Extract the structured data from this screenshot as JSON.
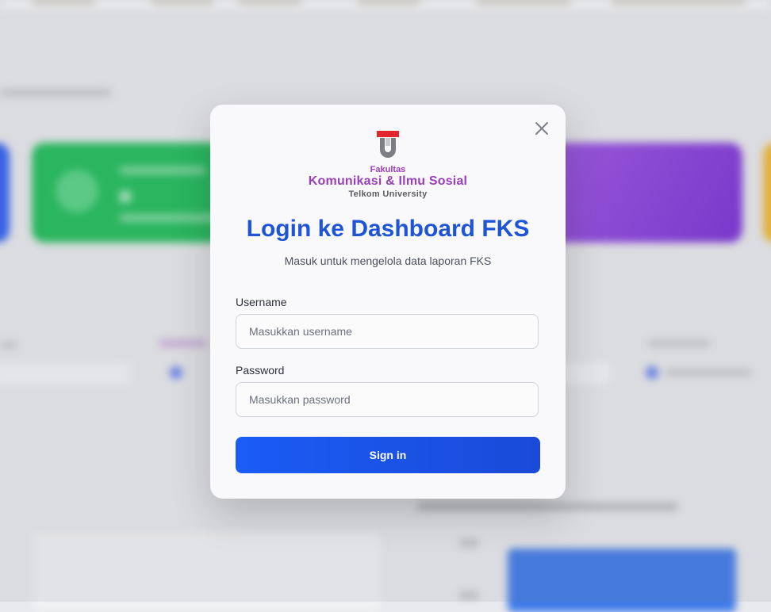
{
  "modal": {
    "logo": {
      "faculty_prefix": "Fakultas",
      "faculty_name": "Komunikasi & Ilmu Sosial",
      "university": "Telkom University"
    },
    "title": "Login ke Dashboard FKS",
    "subtitle": "Masuk untuk mengelola data laporan FKS",
    "username": {
      "label": "Username",
      "placeholder": "Masukkan username",
      "value": ""
    },
    "password": {
      "label": "Password",
      "placeholder": "Masukkan password",
      "value": ""
    },
    "signin_label": "Sign in",
    "close_icon": "close-icon"
  },
  "colors": {
    "accent": "#1e54d6",
    "button": "#1a5cf5",
    "logo_purple": "#9b3fb5",
    "logo_red": "#e3262d"
  }
}
